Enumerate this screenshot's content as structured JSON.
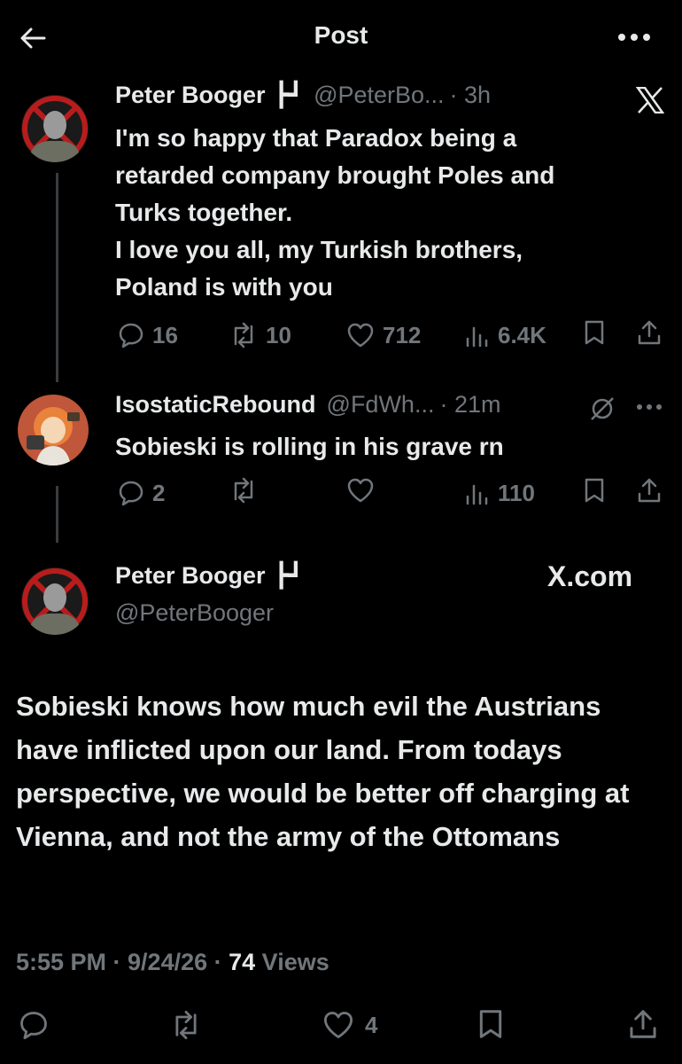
{
  "header": {
    "title": "Post"
  },
  "tweet1": {
    "name": "Peter Booger",
    "flag": "┣┛",
    "handle": "@PeterBo...",
    "time": "· 3h",
    "text": "I'm so happy that Paradox being a\nretarded company brought Poles and\nTurks together.\nI love you all, my Turkish brothers,\nPoland is with you",
    "replies": "16",
    "retweets": "10",
    "likes": "712",
    "views": "6.4K"
  },
  "tweet2": {
    "name": "IsostaticRebound",
    "handle": "@FdWh...",
    "time": "· 21m",
    "text": "Sobieski is rolling in his grave rn",
    "replies": "2",
    "views": "110"
  },
  "main": {
    "name": "Peter Booger",
    "flag": "┣┛",
    "handle": "@PeterBooger",
    "source": "X.com",
    "text": "Sobieski knows how much evil the Austrians have inflicted upon our land. From todays perspective, we would be better off charging at Vienna, and not the army of the Ottomans",
    "timestamp": "5:55 PM · 9/24/26 · ",
    "views_count": "74",
    "views_label": " Views",
    "likes": "4"
  },
  "colors": {
    "bg": "#000000",
    "text": "#e7e9ea",
    "muted": "#71767b"
  }
}
